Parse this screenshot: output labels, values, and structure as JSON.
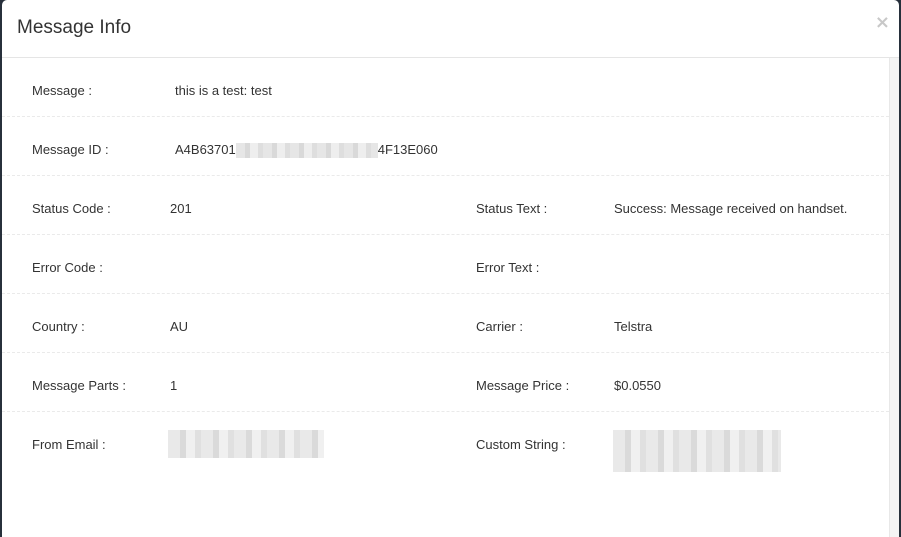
{
  "modal": {
    "title": "Message Info",
    "close_glyph": "×"
  },
  "rows": {
    "message": {
      "label": "Message :",
      "value": "this is a test: test"
    },
    "message_id": {
      "label": "Message ID :",
      "value_prefix": "A4B63701",
      "value_suffix": "4F13E060"
    },
    "status_code": {
      "label": "Status Code :",
      "value": "201"
    },
    "status_text": {
      "label": "Status Text :",
      "value": "Success: Message received on handset."
    },
    "error_code": {
      "label": "Error Code :",
      "value": ""
    },
    "error_text": {
      "label": "Error Text :",
      "value": ""
    },
    "country": {
      "label": "Country :",
      "value": "AU"
    },
    "carrier": {
      "label": "Carrier :",
      "value": "Telstra"
    },
    "message_parts": {
      "label": "Message Parts :",
      "value": "1"
    },
    "message_price": {
      "label": "Message Price :",
      "value": "$0.0550"
    },
    "from_email": {
      "label": "From Email :"
    },
    "custom_string": {
      "label": "Custom String :"
    }
  }
}
